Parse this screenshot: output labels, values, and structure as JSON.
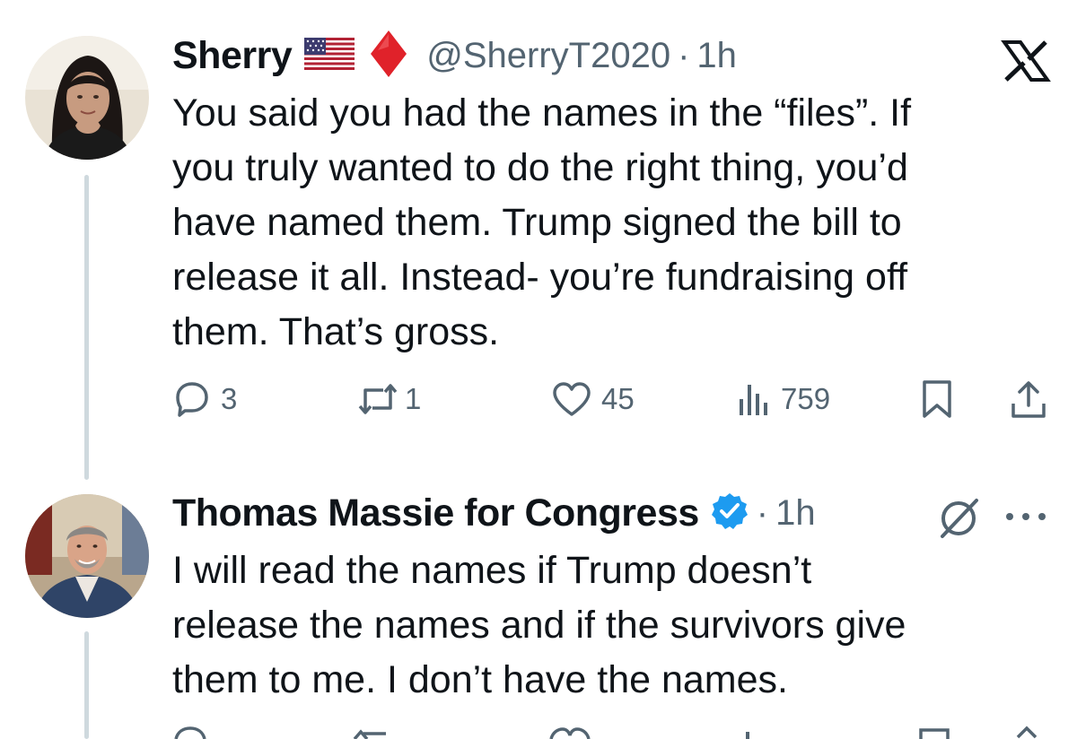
{
  "tweets": [
    {
      "display_name": "Sherry",
      "handle": "@SherryT2020",
      "separator": "·",
      "time": "1h",
      "emoji": [
        "flag-us-icon",
        "red-diamond-icon"
      ],
      "text_lines": [
        "You said you had the names in the “files”. If",
        "you truly wanted to do the right thing, you’d",
        "have named them. Trump signed the bill to",
        "release it all. Instead- you’re fundraising off",
        "them. That’s gross."
      ],
      "stats": {
        "replies": "3",
        "reposts": "1",
        "likes": "45",
        "views": "759"
      }
    },
    {
      "display_name": "Thomas Massie for Congress",
      "separator": "·",
      "time": "1h",
      "verified": true,
      "text_lines": [
        "I will read the names if Trump doesn’t",
        "release the names and if the survivors give",
        "them to me. I don’t have the names."
      ]
    }
  ],
  "colors": {
    "text_primary": "#0f1419",
    "text_secondary": "#536471",
    "thread_line": "#cfd9de",
    "verified_blue": "#1d9bf0",
    "flag_red": "#b22234",
    "diamond_red": "#e0222a"
  }
}
